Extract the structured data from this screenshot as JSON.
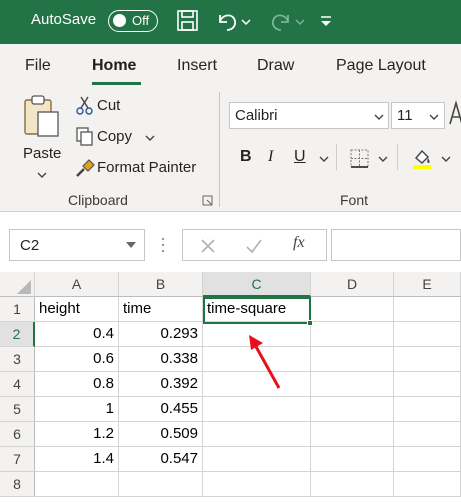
{
  "titlebar": {
    "autosave_label": "AutoSave",
    "autosave_state": "Off",
    "icons": [
      "save-icon",
      "undo-icon",
      "redo-icon",
      "customize-qat-icon"
    ],
    "color": "#227447"
  },
  "tabs": [
    {
      "label": "File",
      "active": false
    },
    {
      "label": "Home",
      "active": true
    },
    {
      "label": "Insert",
      "active": false
    },
    {
      "label": "Draw",
      "active": false
    },
    {
      "label": "Page Layout",
      "active": false
    }
  ],
  "clipboard": {
    "paste": "Paste",
    "cut": "Cut",
    "copy": "Copy",
    "format_painter": "Format Painter",
    "group_label": "Clipboard"
  },
  "font": {
    "family": "Calibri",
    "size": "11",
    "bold": "B",
    "italic": "I",
    "underline": "U",
    "group_label": "Font"
  },
  "formula_bar": {
    "name_box": "C2",
    "fx": "fx",
    "formula": ""
  },
  "sheet": {
    "columns": [
      "A",
      "B",
      "C",
      "D",
      "E"
    ],
    "selected_column": "C",
    "rows": [
      "1",
      "2",
      "3",
      "4",
      "5",
      "6",
      "7",
      "8"
    ],
    "selected_row": "2",
    "header_row": [
      "height",
      "time",
      "time-square"
    ],
    "data": [
      [
        "0.4",
        "0.293",
        ""
      ],
      [
        "0.6",
        "0.338",
        ""
      ],
      [
        "0.8",
        "0.392",
        ""
      ],
      [
        "1",
        "0.455",
        ""
      ],
      [
        "1.2",
        "0.509",
        ""
      ],
      [
        "1.4",
        "0.547",
        ""
      ]
    ],
    "active_cell": "C2",
    "annotation_color": "#e8101a"
  }
}
